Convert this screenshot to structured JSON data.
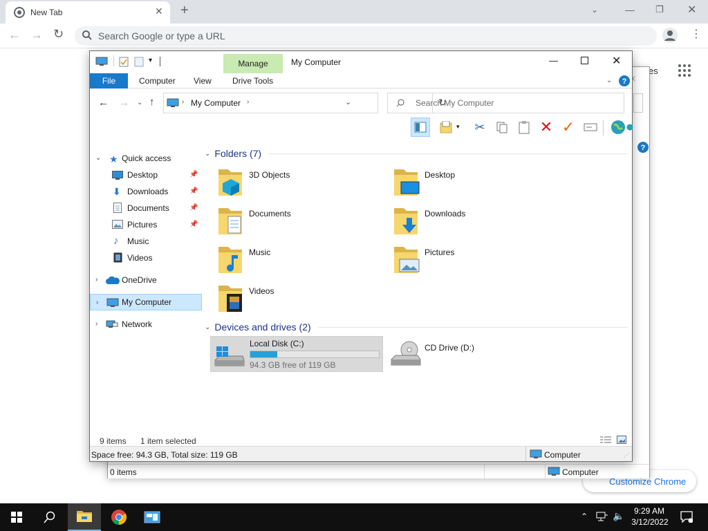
{
  "chrome": {
    "tab_title": "New Tab",
    "omnibox_placeholder": "Search Google or type a URL",
    "partial_right_text": "es",
    "customize_label": "Customize Chrome"
  },
  "explorer_back": {
    "items_count": "0 items",
    "location": "Computer"
  },
  "explorer": {
    "title": "My Computer",
    "manage_label": "Manage",
    "ribbon_tabs": [
      "File",
      "Computer",
      "View",
      "Drive Tools"
    ],
    "address": "My Computer",
    "search_placeholder": "Search My Computer",
    "nav": {
      "quick_access": "Quick access",
      "quick_items": [
        "Desktop",
        "Downloads",
        "Documents",
        "Pictures",
        "Music",
        "Videos"
      ],
      "onedrive": "OneDrive",
      "my_computer": "My Computer",
      "network": "Network"
    },
    "folders_header": "Folders (7)",
    "folders": [
      "3D Objects",
      "Desktop",
      "Documents",
      "Downloads",
      "Music",
      "Pictures",
      "Videos"
    ],
    "devices_header": "Devices and drives (2)",
    "drives": [
      {
        "name": "Local Disk (C:)",
        "free_text": "94.3 GB free of 119 GB",
        "used_fraction": 0.21
      },
      {
        "name": "CD Drive (D:)"
      }
    ],
    "status": {
      "items": "9 items",
      "selected": "1 item selected",
      "space": "Space free: 94.3 GB, Total size: 119 GB",
      "location": "Computer"
    }
  },
  "taskbar": {
    "time": "9:29 AM",
    "date": "3/12/2022"
  },
  "colors": {
    "accent": "#1979ca",
    "manage_tab": "#c9eab1",
    "selection": "#cce8ff",
    "drive_bar": "#26a0da"
  }
}
